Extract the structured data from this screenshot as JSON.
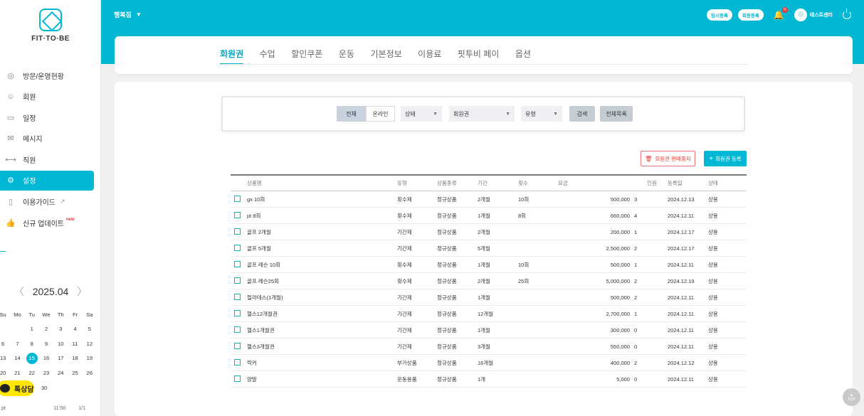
{
  "brand": {
    "logo_text": "FIT·TO·BE"
  },
  "sidebar": {
    "items": [
      {
        "label": "방문/운영현황",
        "icon": "visit-stats-icon",
        "active": false
      },
      {
        "label": "회원",
        "icon": "member-icon",
        "active": false
      },
      {
        "label": "일정",
        "icon": "calendar-icon",
        "active": false
      },
      {
        "label": "메시지",
        "icon": "mail-icon",
        "active": false
      },
      {
        "label": "직원",
        "icon": "dumbbell-icon",
        "active": false
      },
      {
        "label": "설정",
        "icon": "gear-icon",
        "active": true
      },
      {
        "label": "이용가이드",
        "icon": "book-icon",
        "active": false
      },
      {
        "label": "신규 업데이트",
        "icon": "thumbs-up-icon",
        "active": false,
        "badge": "new"
      }
    ]
  },
  "calendar": {
    "month_label": "2025.04",
    "weekdays": [
      "Su",
      "Mo",
      "Tu",
      "We",
      "Th",
      "Fr",
      "Sa"
    ],
    "weeks": [
      [
        "",
        "",
        "1",
        "2",
        "3",
        "4",
        "5"
      ],
      [
        "6",
        "7",
        "8",
        "9",
        "10",
        "11",
        "12"
      ],
      [
        "13",
        "14",
        "15",
        "16",
        "17",
        "18",
        "19"
      ],
      [
        "20",
        "21",
        "22",
        "23",
        "24",
        "25",
        "26"
      ]
    ],
    "last_visible_day": "30",
    "today": "15"
  },
  "chat_button": {
    "label": "톡상담"
  },
  "sidebar_footer": {
    "left": "pt",
    "time": "11:50",
    "page": "1/1"
  },
  "topbar": {
    "branch": "행복짐",
    "temp_register": "임시등록",
    "member_register": "회원등록",
    "notif_count": "N",
    "center_name": "테스트센터"
  },
  "tabs": [
    {
      "label": "회원권",
      "active": true
    },
    {
      "label": "수업",
      "active": false
    },
    {
      "label": "할인쿠폰",
      "active": false
    },
    {
      "label": "운동",
      "active": false
    },
    {
      "label": "기본정보",
      "active": false
    },
    {
      "label": "이용료",
      "active": false
    },
    {
      "label": "핏투비 페이",
      "active": false
    },
    {
      "label": "옵션",
      "active": false
    }
  ],
  "filter": {
    "seg_all": "전체",
    "seg_online": "온라인",
    "status": "상태",
    "membership": "회원권",
    "type": "유형",
    "search": "검색",
    "all_list": "전체목록"
  },
  "actions": {
    "stop_sale": "회원권 판매중지",
    "register": "회원권 등록"
  },
  "table": {
    "headers": {
      "name": "상품명",
      "type": "유형",
      "category": "상품종류",
      "period": "기간",
      "count": "횟수",
      "fee": "요금",
      "people": "인원",
      "reg_date": "등록일",
      "status": "상태"
    },
    "rows": [
      {
        "name": "gx 10회",
        "type": "횟수제",
        "category": "정규상품",
        "period": "2개월",
        "count": "10회",
        "price": "500,000",
        "people": "3",
        "reg_date": "2024.12.13",
        "status": "상용"
      },
      {
        "name": "pt 8회",
        "type": "횟수제",
        "category": "정규상품",
        "period": "1개월",
        "count": "8회",
        "price": "660,000",
        "people": "4",
        "reg_date": "2024.12.11",
        "status": "상용"
      },
      {
        "name": "골프 2개월",
        "type": "기간제",
        "category": "정규상품",
        "period": "2개월",
        "count": "",
        "price": "200,000",
        "people": "1",
        "reg_date": "2024.12.17",
        "status": "상용"
      },
      {
        "name": "골프 5개월",
        "type": "기간제",
        "category": "정규상품",
        "period": "5개월",
        "count": "",
        "price": "2,500,000",
        "people": "2",
        "reg_date": "2024.12.17",
        "status": "상용"
      },
      {
        "name": "골프 레슨 10회",
        "type": "횟수제",
        "category": "정규상품",
        "period": "1개월",
        "count": "10회",
        "price": "500,000",
        "people": "1",
        "reg_date": "2024.12.11",
        "status": "상용"
      },
      {
        "name": "골프 레슨25회",
        "type": "횟수제",
        "category": "정규상품",
        "period": "2개월",
        "count": "25회",
        "price": "5,000,000",
        "people": "2",
        "reg_date": "2024.12.19",
        "status": "상용"
      },
      {
        "name": "필라테스(1개월)",
        "type": "기간제",
        "category": "정규상품",
        "period": "1개월",
        "count": "",
        "price": "500,000",
        "people": "2",
        "reg_date": "2024.12.11",
        "status": "상용"
      },
      {
        "name": "헬스12개월권",
        "type": "기간제",
        "category": "정규상품",
        "period": "12개월",
        "count": "",
        "price": "2,700,000",
        "people": "1",
        "reg_date": "2024.12.11",
        "status": "상용"
      },
      {
        "name": "헬스1개월권",
        "type": "기간제",
        "category": "정규상품",
        "period": "1개월",
        "count": "",
        "price": "300,000",
        "people": "0",
        "reg_date": "2024.12.11",
        "status": "상용"
      },
      {
        "name": "헬스3개월권",
        "type": "기간제",
        "category": "정규상품",
        "period": "3개월",
        "count": "",
        "price": "550,000",
        "people": "0",
        "reg_date": "2024.12.11",
        "status": "상용"
      },
      {
        "name": "락커",
        "type": "부가상품",
        "category": "정규상품",
        "period": "16개월",
        "count": "",
        "price": "400,000",
        "people": "2",
        "reg_date": "2024.12.12",
        "status": "상용"
      },
      {
        "name": "양말",
        "type": "운동용품",
        "category": "정규상품",
        "period": "1개",
        "count": "",
        "price": "5,000",
        "people": "0",
        "reg_date": "2024.12.11",
        "status": "상용"
      }
    ]
  },
  "top_button": {
    "label": "TOP"
  },
  "colors": {
    "accent": "#00b8d4",
    "danger": "#e53935"
  }
}
